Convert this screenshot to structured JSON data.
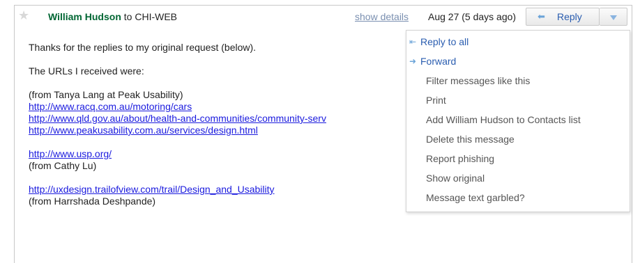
{
  "header": {
    "sender": "William Hudson",
    "to_text": "to CHI-WEB",
    "show_details": "show details",
    "date": "Aug 27 (5 days ago)",
    "reply_label": "Reply"
  },
  "body": {
    "line1": "Thanks for the replies to my original request (below).",
    "line2": "The URLs I received were:",
    "group1_from": "(from Tanya Lang at Peak Usability)",
    "links1": [
      "http://www.racq.com.au/motoring/cars",
      "http://www.qld.gov.au/about/health-and-communities/community-serv",
      "http://www.peakusability.com.au/services/design.html"
    ],
    "link2": "http://www.usp.org/",
    "group2_from": "(from Cathy Lu)",
    "link3": "http://uxdesign.trailofview.com/trail/Design_and_Usability",
    "group3_from": "(from Harrshada Deshpande)"
  },
  "menu": {
    "items": [
      {
        "label": "Reply to all",
        "icon": "reply-all-icon"
      },
      {
        "label": "Forward",
        "icon": "forward-icon"
      },
      {
        "label": "Filter messages like this"
      },
      {
        "label": "Print"
      },
      {
        "label": "Add William Hudson to Contacts list"
      },
      {
        "label": "Delete this message"
      },
      {
        "label": "Report phishing"
      },
      {
        "label": "Show original"
      },
      {
        "label": "Message text garbled?"
      }
    ]
  },
  "colors": {
    "sender": "#006633",
    "link": "#1a1ade",
    "menu_accent": "#2a5db0"
  }
}
